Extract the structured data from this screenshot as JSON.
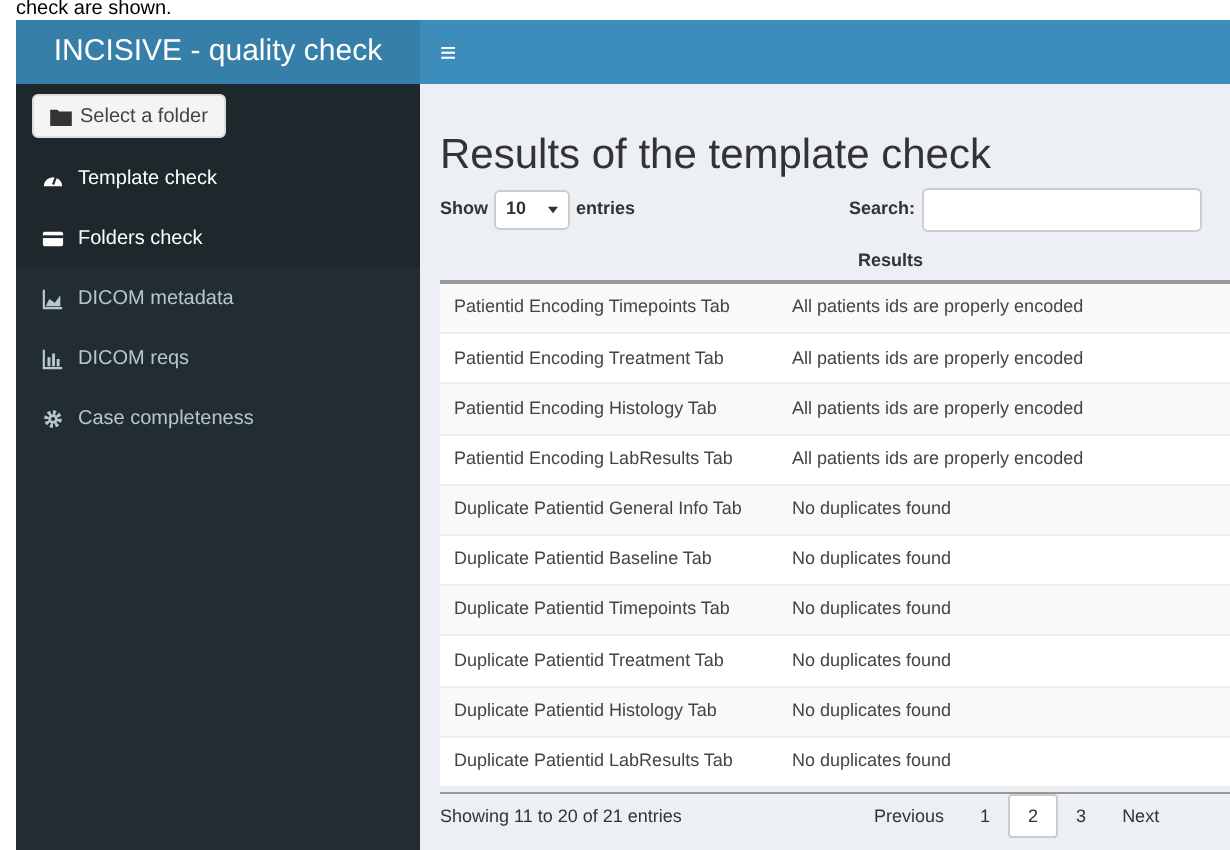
{
  "caption": "check are shown.",
  "app": {
    "title": "INCISIVE - quality check",
    "menu_icon": "≡"
  },
  "sidebar": {
    "folder_button": "Select a folder",
    "items": [
      {
        "label": "Template check",
        "selected": true
      },
      {
        "label": "Folders check",
        "selected": true
      },
      {
        "label": "DICOM metadata",
        "selected": false
      },
      {
        "label": "DICOM reqs",
        "selected": false
      },
      {
        "label": "Case completeness",
        "selected": false
      }
    ]
  },
  "page": {
    "heading": "Results of the template check",
    "length": {
      "before": "Show",
      "value": "10",
      "after": "entries"
    },
    "search": {
      "label": "Search:"
    },
    "table": {
      "columns": [
        "",
        "Results"
      ],
      "rows": [
        [
          "Patientid Encoding Timepoints Tab",
          "All patients ids are properly encoded"
        ],
        [
          "Patientid Encoding Treatment Tab",
          "All patients ids are properly encoded"
        ],
        [
          "Patientid Encoding Histology Tab",
          "All patients ids are properly encoded"
        ],
        [
          "Patientid Encoding LabResults Tab",
          "All patients ids are properly encoded"
        ],
        [
          "Duplicate Patientid General Info Tab",
          "No duplicates found"
        ],
        [
          "Duplicate Patientid Baseline Tab",
          "No duplicates found"
        ],
        [
          "Duplicate Patientid Timepoints Tab",
          "No duplicates found"
        ],
        [
          "Duplicate Patientid Treatment Tab",
          "No duplicates found"
        ],
        [
          "Duplicate Patientid Histology Tab",
          "No duplicates found"
        ],
        [
          "Duplicate Patientid LabResults Tab",
          "No duplicates found"
        ]
      ]
    },
    "info": "Showing 11 to 20 of 21 entries",
    "pagination": [
      {
        "label": "Previous",
        "selected": false
      },
      {
        "label": "1",
        "selected": false
      },
      {
        "label": "2",
        "selected": true
      },
      {
        "label": "3",
        "selected": false
      },
      {
        "label": "Next",
        "selected": false
      }
    ]
  }
}
